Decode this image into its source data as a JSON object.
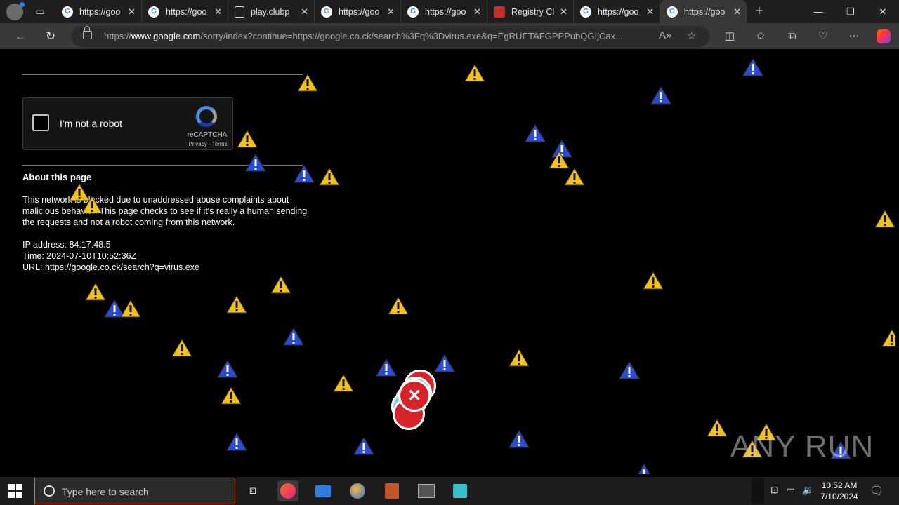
{
  "tabs": [
    {
      "title": "https://goo",
      "icon": "google-icon"
    },
    {
      "title": "https://goo",
      "icon": "google-icon"
    },
    {
      "title": "play.clubp",
      "icon": "document-icon"
    },
    {
      "title": "https://goo",
      "icon": "google-icon"
    },
    {
      "title": "https://goo",
      "icon": "google-icon"
    },
    {
      "title": "Registry Cl",
      "icon": "registry-icon"
    },
    {
      "title": "https://goo",
      "icon": "google-icon"
    },
    {
      "title": "https://goo",
      "icon": "google-icon"
    }
  ],
  "address": {
    "prefix": "https://",
    "domain": "www.google.com",
    "rest": "/sorry/index?continue=https://google.co.ck/search%3Fq%3Dvirus.exe&q=EgRUETAFGPPPubQGIjCax..."
  },
  "captcha": {
    "label": "I'm not a robot",
    "brand": "reCAPTCHA",
    "links": "Privacy - Terms"
  },
  "about": {
    "heading": "About this page",
    "body": "This network is blocked due to unaddressed abuse complaints about malicious behavior. This page checks to see if it's really a human sending the requests and not a robot coming from this network.",
    "ip": "IP address: 84.17.48.5",
    "time": "Time: 2024-07-10T10:52:36Z",
    "url": "URL: https://google.co.ck/search?q=virus.exe"
  },
  "watermark": "ANY RUN",
  "taskbar": {
    "search_placeholder": "Type here to search",
    "time": "10:52 AM",
    "date": "7/10/2024"
  },
  "colors": {
    "warning_yellow": "#f2c21b",
    "warning_blue": "#2b4bd6",
    "error_red": "#d8232a",
    "search_border": "#e06c1f"
  }
}
